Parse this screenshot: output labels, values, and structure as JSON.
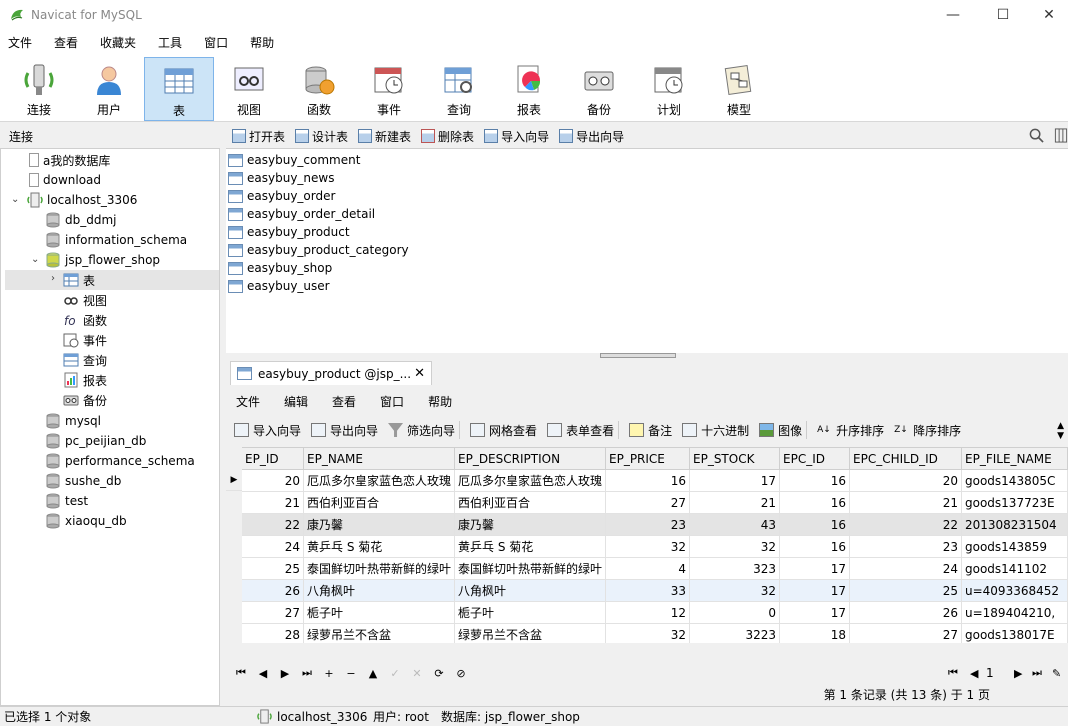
{
  "window": {
    "title": "Navicat for MySQL",
    "controls": [
      "—",
      "☐",
      "✕"
    ]
  },
  "menu": [
    "文件",
    "查看",
    "收藏夹",
    "工具",
    "窗口",
    "帮助"
  ],
  "toolbar": [
    {
      "label": "连接",
      "icon": "connection-icon"
    },
    {
      "label": "用户",
      "icon": "user-icon"
    },
    {
      "label": "表",
      "icon": "table-icon",
      "active": true
    },
    {
      "label": "视图",
      "icon": "view-icon"
    },
    {
      "label": "函数",
      "icon": "function-icon"
    },
    {
      "label": "事件",
      "icon": "event-icon"
    },
    {
      "label": "查询",
      "icon": "query-icon"
    },
    {
      "label": "报表",
      "icon": "report-icon"
    },
    {
      "label": "备份",
      "icon": "backup-icon"
    },
    {
      "label": "计划",
      "icon": "schedule-icon"
    },
    {
      "label": "模型",
      "icon": "model-icon"
    }
  ],
  "left_panel": {
    "header": "连接",
    "tree": [
      {
        "label": "a我的数据库",
        "icon": "file-icon"
      },
      {
        "label": "download",
        "icon": "file-icon"
      },
      {
        "label": "localhost_3306",
        "icon": "server-icon",
        "expanded": true
      },
      {
        "label": "db_ddmj",
        "icon": "database-icon"
      },
      {
        "label": "information_schema",
        "icon": "database-icon"
      },
      {
        "label": "jsp_flower_shop",
        "icon": "database-open-icon",
        "expanded": true
      },
      {
        "label": "表",
        "icon": "table-folder-icon",
        "selected": true
      },
      {
        "label": "视图",
        "icon": "view-folder-icon"
      },
      {
        "label": "函数",
        "icon": "function-folder-icon"
      },
      {
        "label": "事件",
        "icon": "event-folder-icon"
      },
      {
        "label": "查询",
        "icon": "query-folder-icon"
      },
      {
        "label": "报表",
        "icon": "report-folder-icon"
      },
      {
        "label": "备份",
        "icon": "backup-folder-icon"
      },
      {
        "label": "mysql",
        "icon": "database-icon"
      },
      {
        "label": "pc_peijian_db",
        "icon": "database-icon"
      },
      {
        "label": "performance_schema",
        "icon": "database-icon"
      },
      {
        "label": "sushe_db",
        "icon": "database-icon"
      },
      {
        "label": "test",
        "icon": "database-icon"
      },
      {
        "label": "xiaoqu_db",
        "icon": "database-icon"
      }
    ]
  },
  "object_toolbar": [
    "打开表",
    "设计表",
    "新建表",
    "删除表",
    "导入向导",
    "导出向导"
  ],
  "tables": [
    "easybuy_comment",
    "easybuy_news",
    "easybuy_order",
    "easybuy_order_detail",
    "easybuy_product",
    "easybuy_product_category",
    "easybuy_shop",
    "easybuy_user"
  ],
  "editor": {
    "tab_label": "easybuy_product @jsp_...",
    "menu": [
      "文件",
      "编辑",
      "查看",
      "窗口",
      "帮助"
    ],
    "toolbar": [
      "导入向导",
      "导出向导",
      "筛选向导",
      "网格查看",
      "表单查看",
      "备注",
      "十六进制",
      "图像",
      "升序排序",
      "降序排序"
    ],
    "columns": [
      "EP_ID",
      "EP_NAME",
      "EP_DESCRIPTION",
      "EP_PRICE",
      "EP_STOCK",
      "EPC_ID",
      "EPC_CHILD_ID",
      "EP_FILE_NAME"
    ],
    "rows": [
      [
        "20",
        "厄瓜多尔皇家蓝色恋人玫瑰",
        "厄瓜多尔皇家蓝色恋人玫瑰",
        "16",
        "17",
        "16",
        "20",
        "goods143805C"
      ],
      [
        "21",
        "西伯利亚百合",
        "西伯利亚百合",
        "27",
        "21",
        "16",
        "21",
        "goods137723E"
      ],
      [
        "22",
        "康乃馨",
        "康乃馨",
        "23",
        "43",
        "16",
        "22",
        "201308231504"
      ],
      [
        "24",
        "黄乒乓 S 菊花",
        "黄乒乓 S 菊花",
        "32",
        "32",
        "16",
        "23",
        "goods143859"
      ],
      [
        "25",
        "泰国鲜切叶热带新鲜的绿叶",
        "泰国鲜切叶热带新鲜的绿叶",
        "4",
        "323",
        "17",
        "24",
        "goods141102"
      ],
      [
        "26",
        "八角枫叶",
        "八角枫叶",
        "33",
        "32",
        "17",
        "25",
        "u=4093368452"
      ],
      [
        "27",
        "栀子叶",
        "栀子叶",
        "12",
        "0",
        "17",
        "26",
        "u=189404210,"
      ],
      [
        "28",
        "绿萝吊兰不含盆",
        "绿萝吊兰不含盆",
        "32",
        "3223",
        "18",
        "27",
        "goods138017E"
      ]
    ],
    "nav_buttons": [
      "⏮",
      "◀",
      "▶",
      "⏭",
      "+",
      "−",
      "▲",
      "✓",
      "✕",
      "⟳",
      "⊘"
    ],
    "page_value": "1",
    "record_status": "第 1 条记录 (共 13 条) 于 1 页"
  },
  "status": {
    "left": "已选择 1 个对象",
    "connection": "localhost_3306",
    "user": "用户: root",
    "database": "数据库: jsp_flower_shop"
  }
}
